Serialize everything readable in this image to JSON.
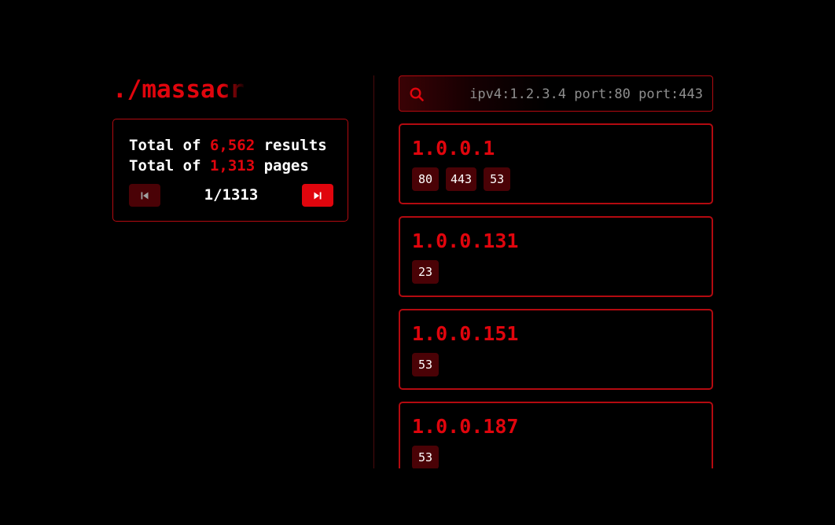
{
  "app": {
    "logo_text": "./massacr"
  },
  "stats": {
    "line1_prefix": "Total of ",
    "total_results": "6,562",
    "line1_suffix": " results",
    "line2_prefix": "Total of ",
    "total_pages": "1,313",
    "line2_suffix": " pages"
  },
  "pager": {
    "current": "1/1313",
    "first_icon": "skip-previous-icon",
    "last_icon": "skip-next-icon"
  },
  "search": {
    "value": "ipv4:1.2.3.4 port:80 port:443",
    "icon": "search-icon"
  },
  "results": [
    {
      "ip": "1.0.0.1",
      "ports": [
        "80",
        "443",
        "53"
      ]
    },
    {
      "ip": "1.0.0.131",
      "ports": [
        "23"
      ]
    },
    {
      "ip": "1.0.0.151",
      "ports": [
        "53"
      ]
    },
    {
      "ip": "1.0.0.187",
      "ports": [
        "53"
      ]
    }
  ],
  "colors": {
    "accent": "#e0050d",
    "border": "#b30a10",
    "badge_bg": "#4a0206",
    "background": "#000000"
  }
}
